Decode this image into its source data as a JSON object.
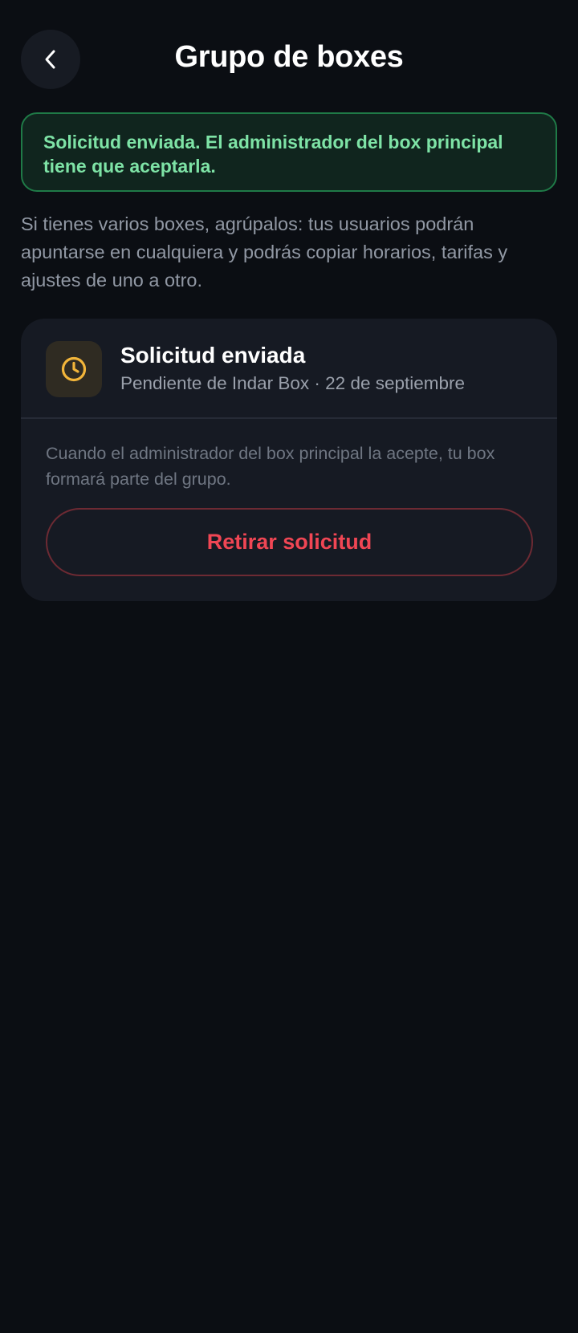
{
  "header": {
    "title": "Grupo de boxes",
    "back_icon": "chevron-left-icon"
  },
  "notice": {
    "text": "Solicitud enviada. El administrador del box principal tiene que aceptarla.",
    "color": "#7ee3a6"
  },
  "description": "Si tienes varios boxes, agrúpalos: tus usuarios podrán apuntarse en cualquiera y podrás copiar horarios, tarifas y ajustes de uno a otro.",
  "request_card": {
    "icon": "clock-icon",
    "title": "Solicitud enviada",
    "subtitle": "Pendiente de Indar Box · 22 de septiembre",
    "note": "Cuando el administrador del box principal la acepte, tu box formará parte del grupo.",
    "withdraw_label": "Retirar solicitud",
    "accent_color": "#f2b53a",
    "danger_color": "#f04654"
  }
}
